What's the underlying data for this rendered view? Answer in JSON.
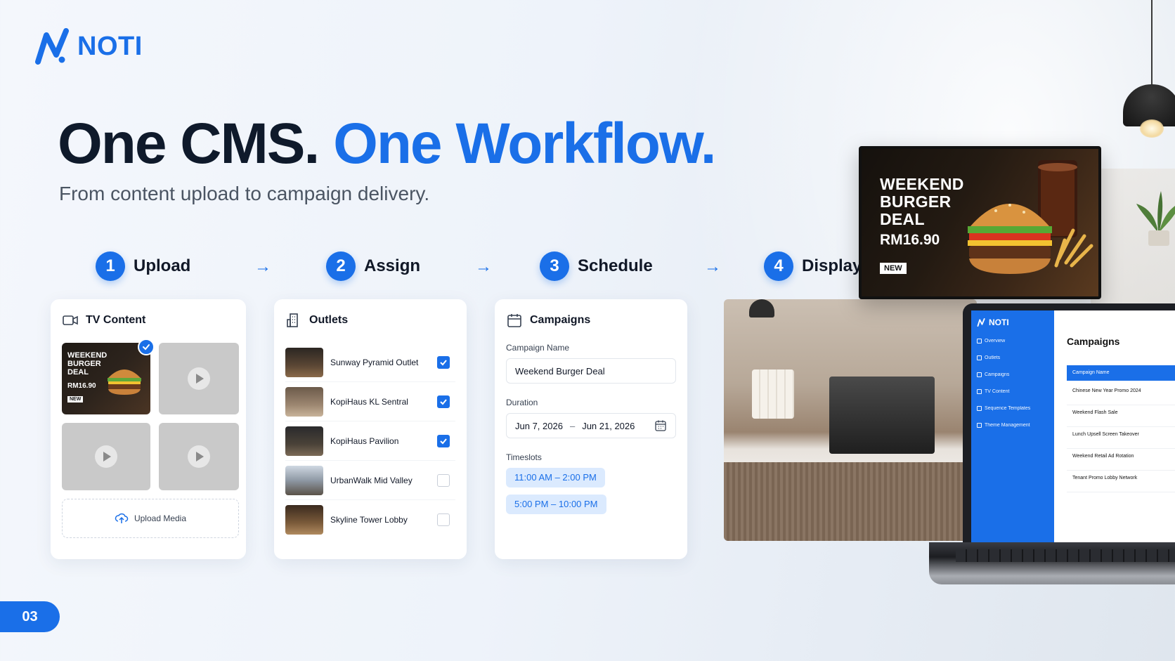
{
  "brand": {
    "name": "NOTI",
    "color": "#1a6fe8"
  },
  "headline": {
    "part1": "One CMS.",
    "part2": "One Workflow."
  },
  "subtitle": "From content upload to campaign delivery.",
  "steps": [
    {
      "num": "1",
      "label": "Upload"
    },
    {
      "num": "2",
      "label": "Assign"
    },
    {
      "num": "3",
      "label": "Schedule"
    },
    {
      "num": "4",
      "label": "Display"
    }
  ],
  "tv_content": {
    "title": "TV Content",
    "thumb": {
      "title": "WEEKEND BURGER DEAL",
      "price": "RM16.90",
      "badge": "NEW"
    },
    "upload_label": "Upload Media"
  },
  "outlets": {
    "title": "Outlets",
    "items": [
      {
        "name": "Sunway Pyramid Outlet",
        "checked": true
      },
      {
        "name": "KopiHaus KL Sentral",
        "checked": true
      },
      {
        "name": "KopiHaus Pavilion",
        "checked": true
      },
      {
        "name": "UrbanWalk Mid Valley",
        "checked": false
      },
      {
        "name": "Skyline Tower Lobby",
        "checked": false
      }
    ]
  },
  "campaigns": {
    "title": "Campaigns",
    "name_label": "Campaign Name",
    "name_value": "Weekend Burger Deal",
    "duration_label": "Duration",
    "date_from": "Jun 7, 2026",
    "date_sep": "–",
    "date_to": "Jun 21, 2026",
    "timeslots_label": "Timeslots",
    "timeslots": [
      "11:00 AM – 2:00 PM",
      "5:00 PM – 10:00 PM"
    ]
  },
  "tv_display": {
    "title": "WEEKEND BURGER DEAL",
    "price": "RM16.90",
    "badge": "NEW"
  },
  "laptop": {
    "brand": "NOTI",
    "nav": [
      "Overview",
      "Outlets",
      "Campaigns",
      "TV Content",
      "Sequence Templates",
      "Theme Management"
    ],
    "title": "Campaigns",
    "table_header": "Campaign Name",
    "rows": [
      "Chinese New Year Promo 2024",
      "Weekend Flash Sale",
      "Lunch Upsell Screen Takeover",
      "Weekend Retail Ad Rotation",
      "Tenant Promo Lobby Network"
    ]
  },
  "page_number": "03"
}
